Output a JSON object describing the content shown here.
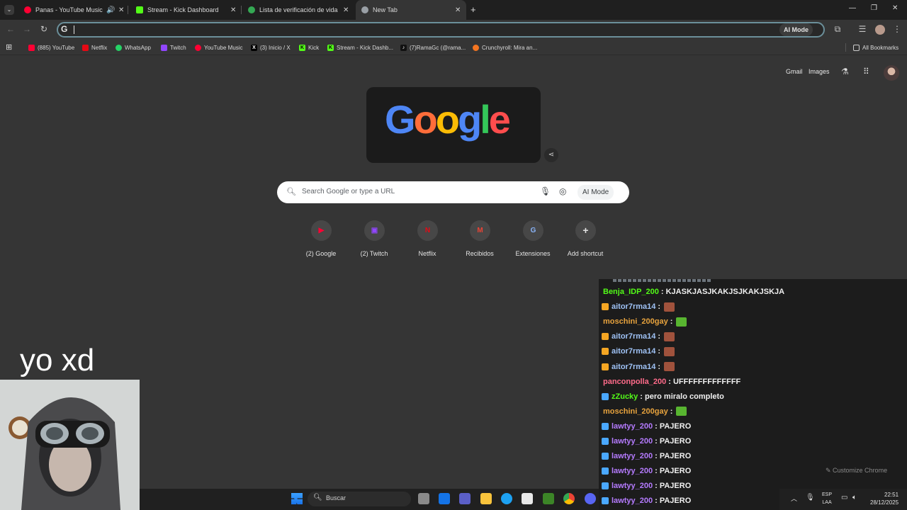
{
  "tabs": [
    {
      "title": "Panas - YouTube Music",
      "icon": "youtube-music-icon",
      "color": "#ff0033"
    },
    {
      "title": "Stream - Kick Dashboard",
      "icon": "kick-icon",
      "color": "#53fc18"
    },
    {
      "title": "Lista de verificación de vida",
      "icon": "check-circle-icon",
      "color": "#34a853"
    },
    {
      "title": "New Tab",
      "icon": "chrome-icon",
      "color": "#9aa0a6"
    }
  ],
  "omnibox": {
    "placeholder": "",
    "ai_mode": "AI Mode"
  },
  "bookmarks": [
    {
      "label": "(885) YouTube",
      "color": "#ff0033",
      "glyph": "▶"
    },
    {
      "label": "Netflix",
      "color": "#e50914",
      "glyph": "N"
    },
    {
      "label": "WhatsApp",
      "color": "#25d366",
      "glyph": "✆"
    },
    {
      "label": "Twitch",
      "color": "#9146ff",
      "glyph": "t"
    },
    {
      "label": "YouTube Music",
      "color": "#ff0033",
      "glyph": "●"
    },
    {
      "label": "(3) Inicio / X",
      "color": "#000000",
      "glyph": "X"
    },
    {
      "label": "Kick",
      "color": "#53fc18",
      "glyph": "K"
    },
    {
      "label": "Stream - Kick Dashb...",
      "color": "#53fc18",
      "glyph": "K"
    },
    {
      "label": "(7)RamaGc (@rama...",
      "color": "#111111",
      "glyph": "♪"
    },
    {
      "label": "Crunchyroll: Mira an...",
      "color": "#f47521",
      "glyph": "C"
    }
  ],
  "all_bookmarks": "All Bookmarks",
  "ntp": {
    "gmail": "Gmail",
    "images": "Images",
    "doodle_text": "Google",
    "search_placeholder": "Search Google or type a URL",
    "ai_mode": "AI Mode",
    "customize": "Customize Chrome"
  },
  "shortcuts": [
    {
      "label": "(2) Google",
      "glyph": "▶",
      "color": "#ff0033"
    },
    {
      "label": "(2) Twitch",
      "glyph": "▣",
      "color": "#9146ff"
    },
    {
      "label": "Netflix",
      "glyph": "N",
      "color": "#e50914"
    },
    {
      "label": "Recibidos",
      "glyph": "M",
      "color": "#ea4335"
    },
    {
      "label": "Extensiones",
      "glyph": "G",
      "color": "#8ab4f8"
    },
    {
      "label": "Add shortcut",
      "glyph": "+",
      "color": "#e3e3e3"
    }
  ],
  "chat": [
    {
      "user": "Benja_IDP_200",
      "text": ": KJASKJASJKAKJSJKAKJSKJA",
      "color": "#53fc18",
      "badge": "",
      "emote": ""
    },
    {
      "user": "aitor7rma14",
      "text": ":",
      "color": "#9fc2f5",
      "badge": "#f5a623",
      "emote": "#a0523c"
    },
    {
      "user": "moschini_200gay",
      "text": ":",
      "color": "#e8a33d",
      "badge": "",
      "emote": "#58b530"
    },
    {
      "user": "aitor7rma14",
      "text": ":",
      "color": "#9fc2f5",
      "badge": "#f5a623",
      "emote": "#a0523c"
    },
    {
      "user": "aitor7rma14",
      "text": ":",
      "color": "#9fc2f5",
      "badge": "#f5a623",
      "emote": "#a0523c"
    },
    {
      "user": "aitor7rma14",
      "text": ":",
      "color": "#9fc2f5",
      "badge": "#f5a623",
      "emote": "#a0523c"
    },
    {
      "user": "panconpolla_200",
      "text": ": UFFFFFFFFFFFFF",
      "color": "#ff6b8a",
      "badge": "",
      "emote": ""
    },
    {
      "user": "zZucky",
      "text": ": pero miralo completo",
      "color": "#53fc18",
      "badge": "#4aa8ff",
      "emote": ""
    },
    {
      "user": "moschini_200gay",
      "text": ":",
      "color": "#e8a33d",
      "badge": "",
      "emote": "#58b530"
    },
    {
      "user": "lawtyy_200",
      "text": ": PAJERO",
      "color": "#b57bff",
      "badge": "#4aa8ff",
      "emote": ""
    },
    {
      "user": "lawtyy_200",
      "text": ": PAJERO",
      "color": "#b57bff",
      "badge": "#4aa8ff",
      "emote": ""
    },
    {
      "user": "lawtyy_200",
      "text": ": PAJERO",
      "color": "#b57bff",
      "badge": "#4aa8ff",
      "emote": ""
    },
    {
      "user": "lawtyy_200",
      "text": ": PAJERO",
      "color": "#b57bff",
      "badge": "#4aa8ff",
      "emote": ""
    },
    {
      "user": "lawtyy_200",
      "text": ": PAJERO",
      "color": "#b57bff",
      "badge": "#4aa8ff",
      "emote": ""
    },
    {
      "user": "lawtyy_200",
      "text": ": PAJERO",
      "color": "#b57bff",
      "badge": "#4aa8ff",
      "emote": ""
    }
  ],
  "webcam_caption": "yo xd",
  "taskbar": {
    "search": "Buscar",
    "lang_1": "ESP",
    "lang_2": "LAA",
    "time": "22:51",
    "date": "28/12/2025"
  }
}
